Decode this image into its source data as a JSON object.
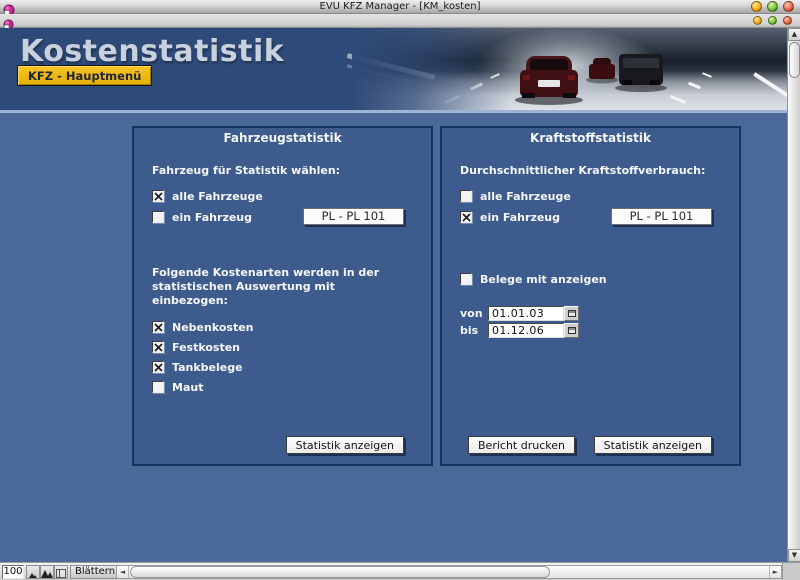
{
  "window": {
    "title": "EVU KFZ Manager - [KM_kosten]"
  },
  "header": {
    "title": "Kostenstatistik",
    "menu_button": "KFZ - Hauptmenü"
  },
  "left_panel": {
    "title": "Fahrzeugstatistik",
    "select_label": "Fahrzeug für Statistik wählen:",
    "checkboxes": [
      {
        "label": "alle Fahrzeuge",
        "checked": true
      },
      {
        "label": "ein Fahrzeug",
        "checked": false
      }
    ],
    "vehicle_value": "PL - PL 101",
    "kostenarten_label": "Folgende Kostenarten werden in der\nstatistischen Auswertung mit einbezogen:",
    "kostenarten": [
      {
        "label": "Nebenkosten",
        "checked": true
      },
      {
        "label": "Festkosten",
        "checked": true
      },
      {
        "label": "Tankbelege",
        "checked": true
      },
      {
        "label": "Maut",
        "checked": false
      }
    ],
    "show_button": "Statistik anzeigen"
  },
  "right_panel": {
    "title": "Kraftstoffstatistik",
    "consumption_label": "Durchschnittlicher Kraftstoffverbrauch:",
    "checkboxes": [
      {
        "label": "alle Fahrzeuge",
        "checked": false
      },
      {
        "label": "ein Fahrzeug",
        "checked": true
      }
    ],
    "vehicle_value": "PL - PL 101",
    "belege_checkbox": {
      "label": "Belege mit anzeigen",
      "checked": false
    },
    "date_from": {
      "label": "von",
      "value": "01.01.03"
    },
    "date_to": {
      "label": "bis",
      "value": "01.12.06"
    },
    "print_button": "Bericht drucken",
    "show_button": "Statistik anzeigen"
  },
  "status_bar": {
    "zoom_level": "100",
    "mode": "Blättern"
  },
  "icons": {
    "up_arrow": "▲",
    "down_arrow": "▼",
    "left_arrow": "◄",
    "right_arrow": "►",
    "dropdown_arrow": "▼"
  },
  "colors": {
    "banner_navy": "#2e4a78",
    "page_background": "#4a6898",
    "panel_background": "#3d5b8c",
    "panel_border": "#16335f",
    "accent_yellow": "#efb710",
    "separator_blue": "#9db4d4"
  }
}
